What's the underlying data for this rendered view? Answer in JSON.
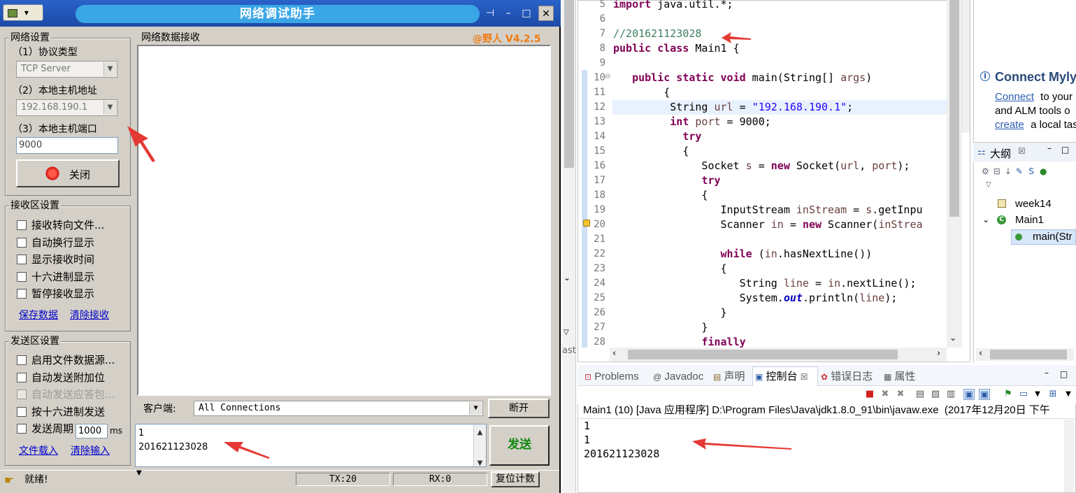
{
  "net_window": {
    "menu_label": "▾",
    "title": "网络调试助手",
    "version_badge": "@野人 V4.2.5",
    "title_buttons": {
      "pin": "⊣",
      "minimize": "–",
      "maximize": "□",
      "close": "✕"
    },
    "network_settings": {
      "title": "网络设置",
      "protocol_label": "（1）协议类型",
      "protocol_value": "TCP Server",
      "host_label": "（2）本地主机地址",
      "host_value": "192.168.190.1",
      "port_label": "（3）本地主机端口",
      "port_value": "9000",
      "close_button": "关闭"
    },
    "receive_settings": {
      "title": "接收区设置",
      "options": [
        "接收转向文件...",
        "自动换行显示",
        "显示接收时间",
        "十六进制显示",
        "暂停接收显示"
      ],
      "save_link": "保存数据",
      "clear_link": "清除接收"
    },
    "send_settings": {
      "title": "发送区设置",
      "options": [
        "启用文件数据源...",
        "自动发送附加位",
        "自动发送应答包...",
        "按十六进制发送",
        "发送周期"
      ],
      "period_value": "1000",
      "period_unit": "ms",
      "load_link": "文件载入",
      "clear_link": "清除输入"
    },
    "receive_area": {
      "title": "网络数据接收"
    },
    "client": {
      "label": "客户端:",
      "value": "All Connections",
      "disconnect_button": "断开"
    },
    "send_text": [
      "1",
      "201621123028"
    ],
    "send_button": "发送",
    "status": {
      "ready": "就绪!",
      "tx": "TX:20",
      "rx": "RX:0",
      "reset_button": "复位计数"
    }
  },
  "editor": {
    "lines": [
      {
        "n": "5",
        "html": "<span class='kw'>import</span> java.util.*;"
      },
      {
        "n": "6",
        "html": ""
      },
      {
        "n": "7",
        "html": "<span class='cmt'>//201621123028</span>"
      },
      {
        "n": "8",
        "html": "<span class='kw'>public class</span> Main1 {"
      },
      {
        "n": "9",
        "html": ""
      },
      {
        "n": "10",
        "html": "   <span class='kw'>public static void</span> main(String[] <span class='var'>args</span>)"
      },
      {
        "n": "11",
        "html": "        {"
      },
      {
        "n": "12",
        "html": "         String <span class='var'>url</span> = <span class='str'>\"192.168.190.1\"</span>;"
      },
      {
        "n": "13",
        "html": "         <span class='kw'>int</span> <span class='var'>port</span> = 9000;"
      },
      {
        "n": "14",
        "html": "           <span class='kw'>try</span>"
      },
      {
        "n": "15",
        "html": "           {"
      },
      {
        "n": "16",
        "html": "              Socket <span class='var'>s</span> = <span class='kw'>new</span> Socket(<span class='var'>url</span>, <span class='var'>port</span>);"
      },
      {
        "n": "17",
        "html": "              <span class='kw'>try</span>"
      },
      {
        "n": "18",
        "html": "              {"
      },
      {
        "n": "19",
        "html": "                 InputStream <span class='var'>inStream</span> = <span class='var'>s</span>.getInpu"
      },
      {
        "n": "20",
        "html": "                 Scanner <span class='var'>in</span> = <span class='kw'>new</span> Scanner(<span class='var'>inStrea</span>"
      },
      {
        "n": "21",
        "html": ""
      },
      {
        "n": "22",
        "html": "                 <span class='kw'>while</span> (<span class='var'>in</span>.hasNextLine())"
      },
      {
        "n": "23",
        "html": "                 {"
      },
      {
        "n": "24",
        "html": "                    String <span class='var'>line</span> = <span class='var'>in</span>.nextLine();"
      },
      {
        "n": "25",
        "html": "                    System.<span class='fld'>out</span>.println(<span class='var'>line</span>);"
      },
      {
        "n": "26",
        "html": "                 }"
      },
      {
        "n": "27",
        "html": "              }"
      },
      {
        "n": "28",
        "html": "              <span class='kw'>finally</span>"
      }
    ]
  },
  "mylyn": {
    "title": "Connect Myly",
    "line1_link": "Connect",
    "line1_rest": " to your",
    "line2": "and ALM tools o",
    "line3_link": "create",
    "line3_rest": " a local tas"
  },
  "outline": {
    "tab_label": "大纲",
    "items": [
      "week14",
      "Main1",
      "main(Str"
    ]
  },
  "console": {
    "tabs": [
      "Problems",
      "Javadoc",
      "声明",
      "控制台",
      "错误日志",
      "属性"
    ],
    "header": "Main1 (10) [Java 应用程序] D:\\Program Files\\Java\\jdk1.8.0_91\\bin\\javaw.exe  (2017年12月20日 下午",
    "output": [
      "1",
      "1",
      "201621123028"
    ]
  },
  "left_edge_text": "aste",
  "colors": {
    "title_blue": "#1c4aa6",
    "pill_blue": "#3aa6e6",
    "accent_red": "#e53935",
    "send_green": "#118811",
    "version_orange": "#f07a10"
  }
}
